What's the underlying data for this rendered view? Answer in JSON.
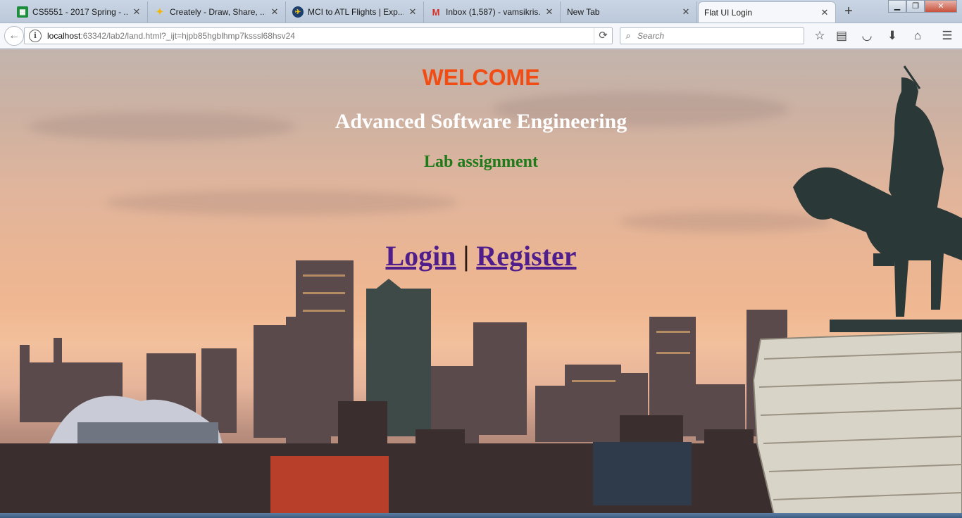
{
  "browser": {
    "tabs": [
      {
        "label": "CS5551 - 2017 Spring - ...",
        "icon": "spreadsheet-icon",
        "color": "#1e8e3e"
      },
      {
        "label": "Creately - Draw, Share, ...",
        "icon": "lightbulb-icon",
        "color": "#f2b705"
      },
      {
        "label": "MCI to ATL Flights | Exp...",
        "icon": "plane-icon",
        "color": "#1c3f6e"
      },
      {
        "label": "Inbox (1,587) - vamsikris...",
        "icon": "gmail-icon",
        "color": "#d93025"
      },
      {
        "label": "New Tab",
        "icon": "",
        "color": ""
      },
      {
        "label": "Flat UI Login",
        "icon": "",
        "color": ""
      }
    ],
    "active_tab": 5,
    "url": {
      "host": "localhost",
      "rest": ":63342/lab2/land.html?_ijt=hjpb85hgblhmp7ksssl68hsv24"
    },
    "search": {
      "placeholder": "Search"
    }
  },
  "page": {
    "welcome": "WELCOME",
    "course": "Advanced Software Engineering",
    "lab": "Lab assignment",
    "login_label": "Login",
    "separator": "|",
    "register_label": "Register",
    "colors": {
      "welcome": "#f04c14",
      "course": "#ffffff",
      "lab": "#1f7a1a",
      "links": "#4f1e8c"
    }
  }
}
